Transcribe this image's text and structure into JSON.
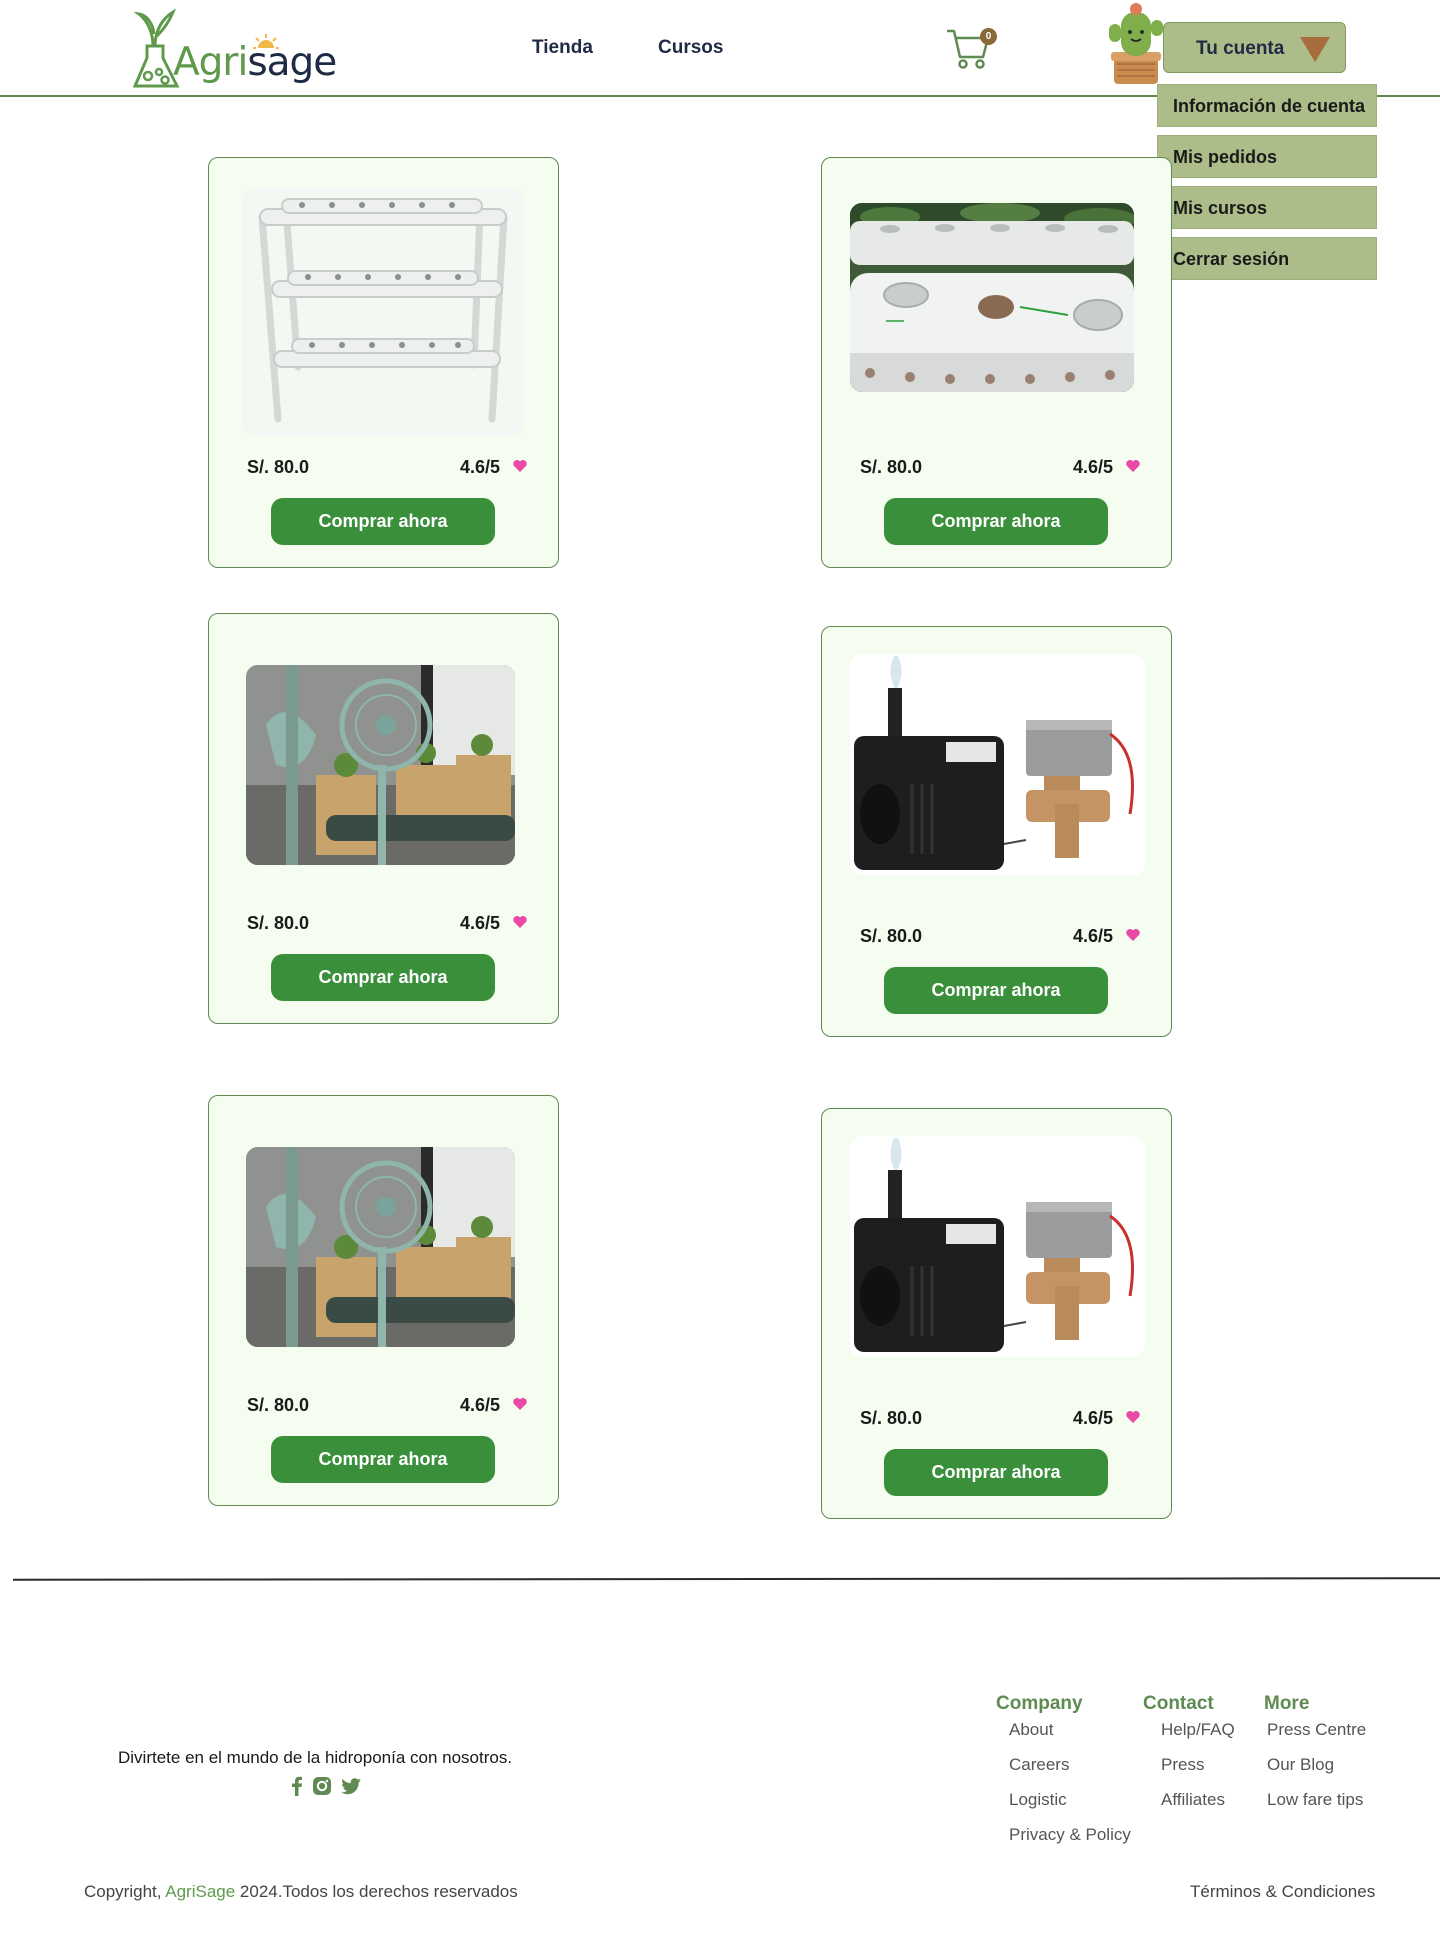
{
  "header": {
    "logo_part1": "Agri",
    "logo_part2": "sage",
    "nav": [
      "Tienda",
      "Cursos"
    ],
    "cart_count": "0",
    "account_label": "Tu cuenta"
  },
  "account_menu": [
    "Información de cuenta",
    "Mis pedidos",
    "Mis cursos",
    "Cerrar sesión"
  ],
  "products": [
    {
      "price": "S/. 80.0",
      "rating": "4.6/5",
      "button": "Comprar ahora",
      "image": "nft-shelf-icon"
    },
    {
      "price": "S/. 80.0",
      "rating": "4.6/5",
      "button": "Comprar ahora",
      "image": "pvc-pipe-icon"
    },
    {
      "price": "S/. 80.0",
      "rating": "4.6/5",
      "button": "Comprar ahora",
      "image": "greenhouse-fan-icon"
    },
    {
      "price": "S/. 80.0",
      "rating": "4.6/5",
      "button": "Comprar ahora",
      "image": "pump-valve-icon"
    },
    {
      "price": "S/. 80.0",
      "rating": "4.6/5",
      "button": "Comprar ahora",
      "image": "greenhouse-fan-icon"
    },
    {
      "price": "S/. 80.0",
      "rating": "4.6/5",
      "button": "Comprar ahora",
      "image": "pump-valve-icon"
    }
  ],
  "footer": {
    "tagline": "Divirtete en el mundo de la hidroponía con nosotros.",
    "columns": [
      {
        "title": "Company",
        "links": [
          "About",
          "Careers",
          "Logistic",
          "Privacy & Policy"
        ]
      },
      {
        "title": "Contact",
        "links": [
          "Help/FAQ",
          "Press",
          "Affiliates"
        ]
      },
      {
        "title": "More",
        "links": [
          "Press Centre",
          "Our Blog",
          "Low fare tips"
        ]
      }
    ],
    "copyright_prefix": "Copyright, ",
    "copyright_brand": "AgriSage",
    "copyright_suffix": " 2024.Todos los derechos reservados",
    "terms": "Términos & Condiciones"
  },
  "colors": {
    "accent_green": "#3a8f3a",
    "menu_bg": "#adbd8a",
    "card_bg": "#f4fdf0",
    "heading_green": "#5f8a52"
  }
}
